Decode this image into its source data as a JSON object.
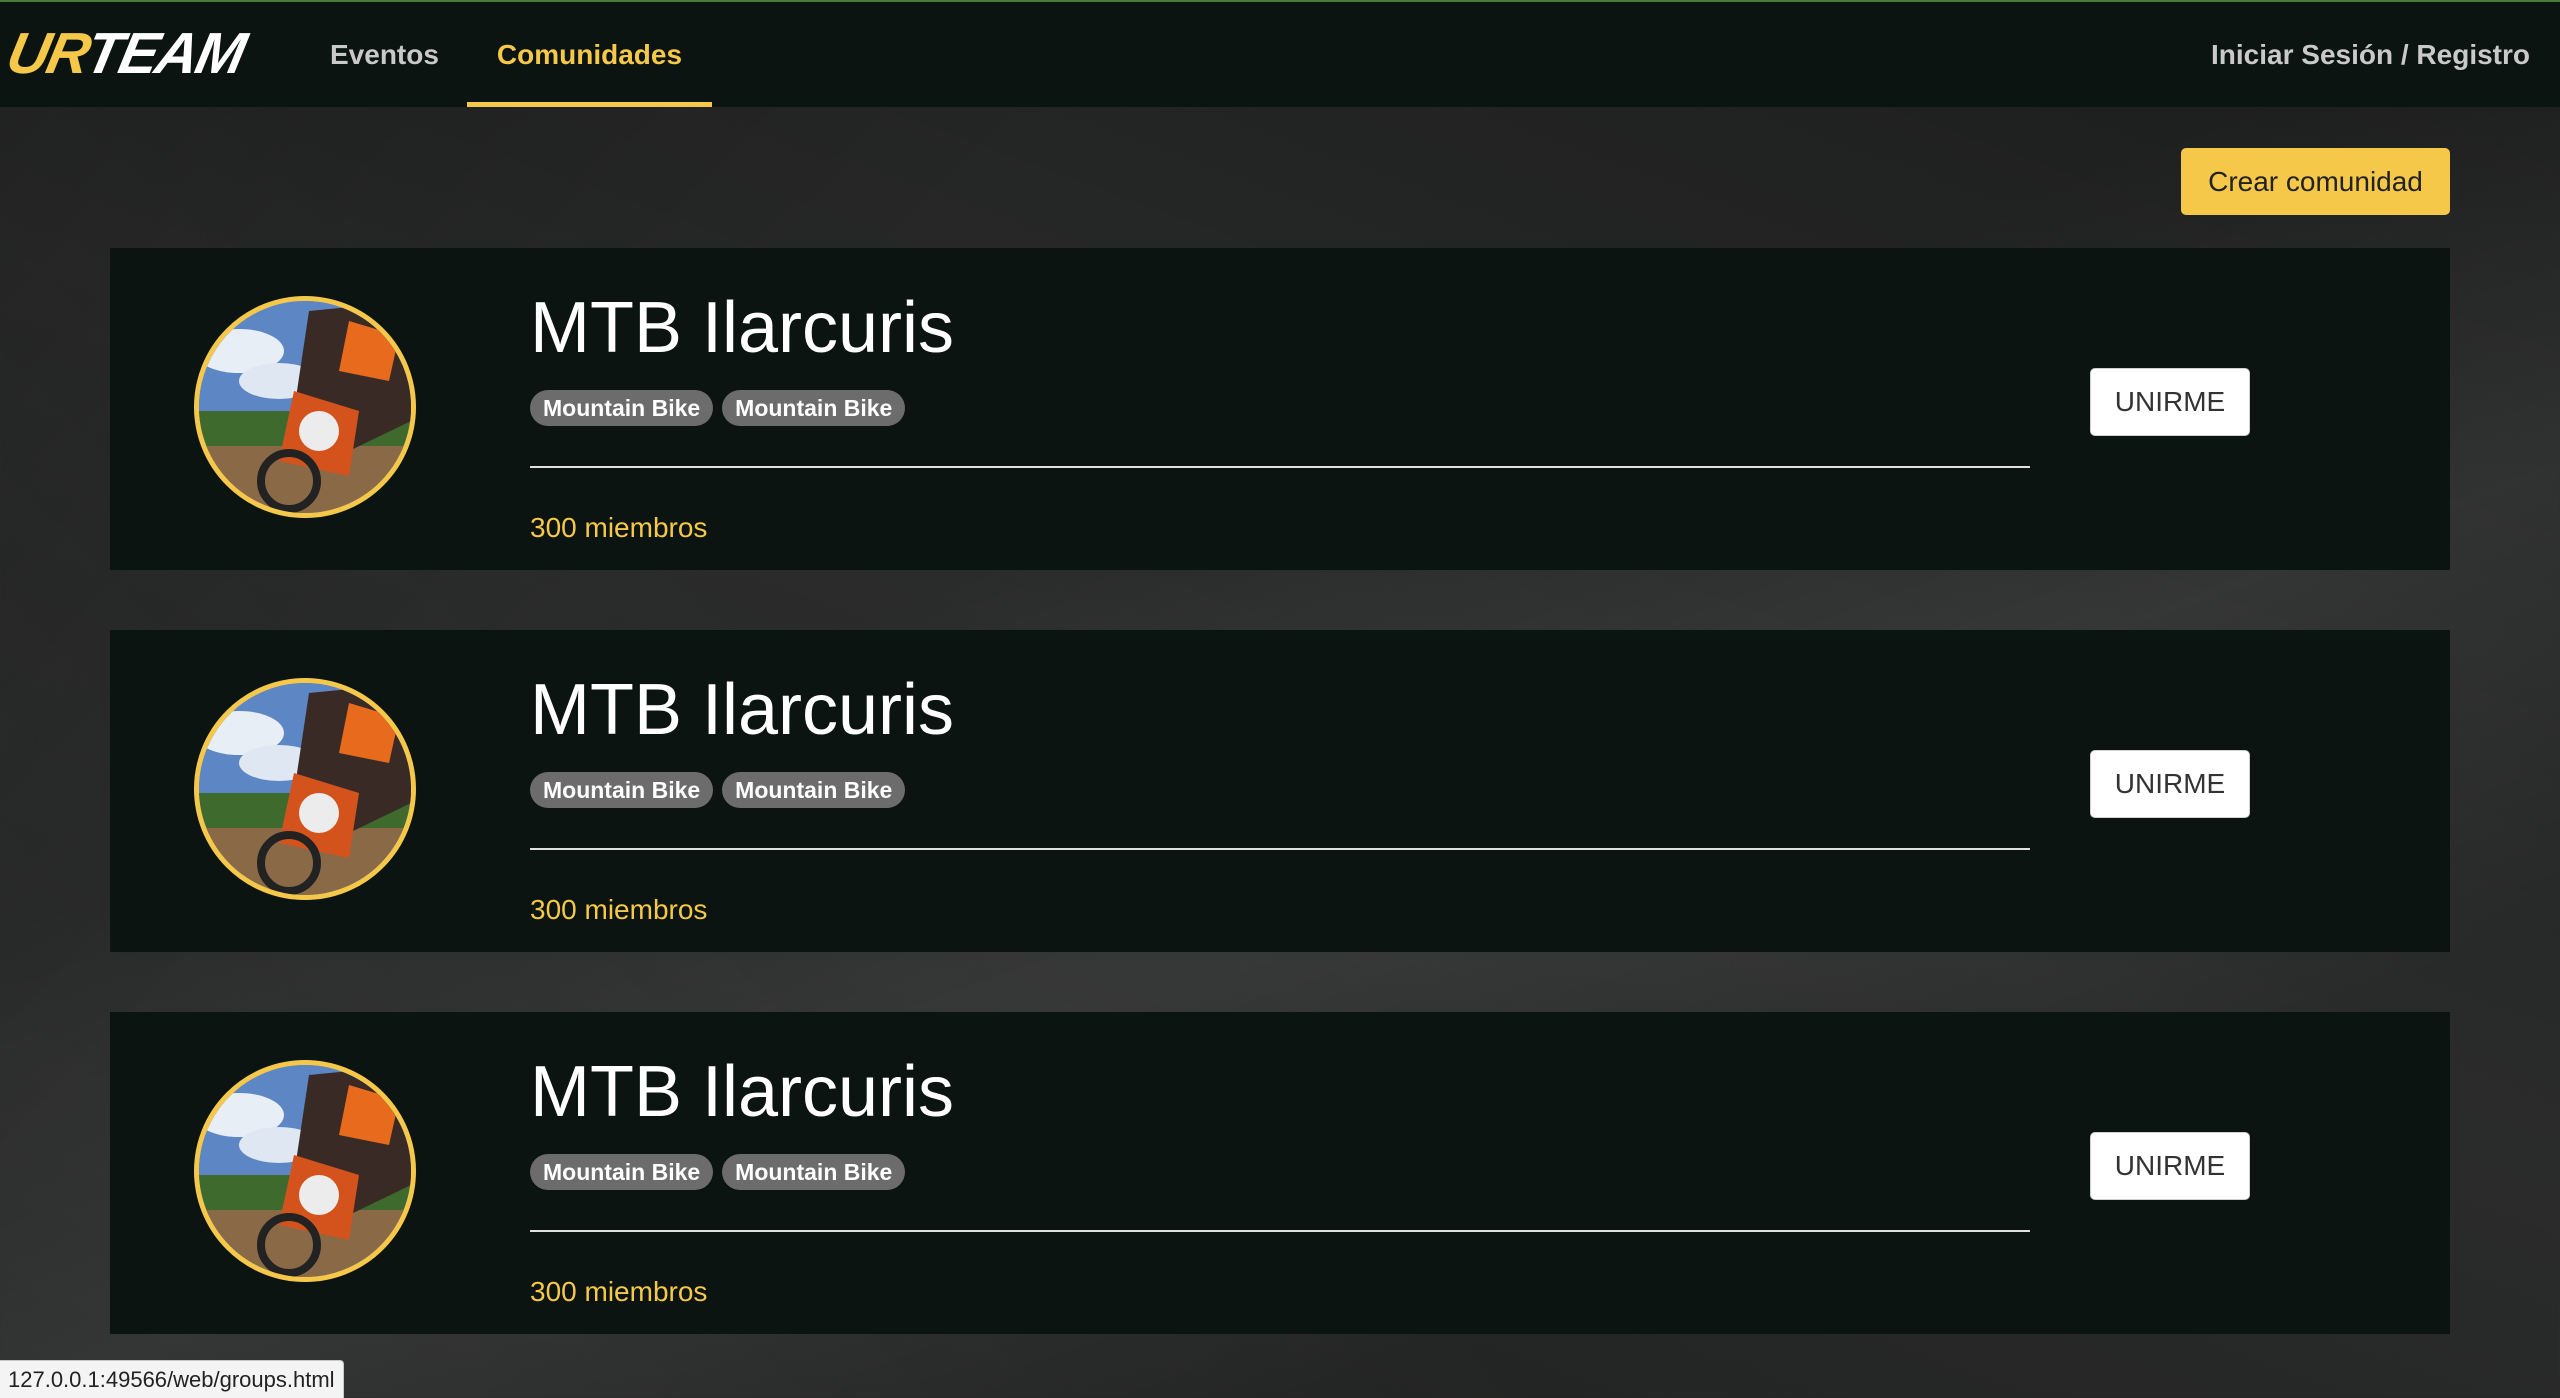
{
  "navbar": {
    "logo_part1": "UR",
    "logo_part2": "TEAM",
    "links": [
      {
        "label": "Eventos",
        "active": false
      },
      {
        "label": "Comunidades",
        "active": true
      }
    ],
    "login_label": "Iniciar Sesión / Registro"
  },
  "actions": {
    "create_label": "Crear comunidad"
  },
  "communities": [
    {
      "name": "MTB Ilarcuris",
      "tags": [
        "Mountain Bike",
        "Mountain Bike"
      ],
      "members": "300 miembros",
      "join_label": "UNIRME"
    },
    {
      "name": "MTB Ilarcuris",
      "tags": [
        "Mountain Bike",
        "Mountain Bike"
      ],
      "members": "300 miembros",
      "join_label": "UNIRME"
    },
    {
      "name": "MTB Ilarcuris",
      "tags": [
        "Mountain Bike",
        "Mountain Bike"
      ],
      "members": "300 miembros",
      "join_label": "UNIRME"
    }
  ],
  "status_bar": {
    "url": "127.0.0.1:49566/web/groups.html"
  },
  "colors": {
    "accent": "#f5c84a",
    "navbar_bg": "#0b1410",
    "card_bg": "#0b1410",
    "tag_bg": "#6c6c6c"
  }
}
